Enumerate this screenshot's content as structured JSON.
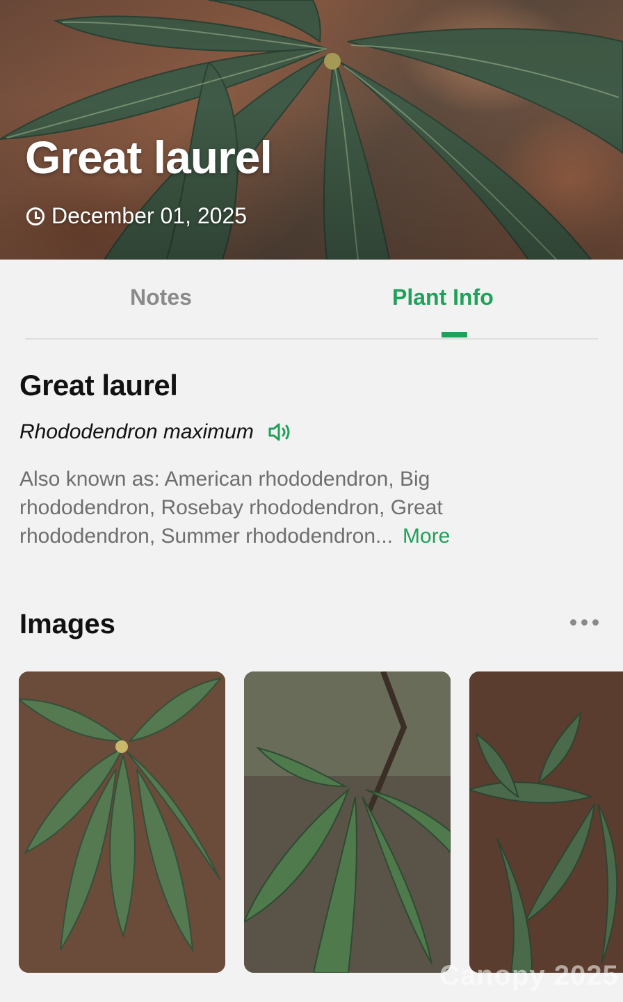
{
  "header": {
    "title": "Great laurel",
    "date": "December 01, 2025",
    "clock_icon": "clock-icon"
  },
  "tabs": [
    {
      "label": "Notes",
      "active": false
    },
    {
      "label": "Plant Info",
      "active": true
    }
  ],
  "colors": {
    "accent": "#1fa15a",
    "inactive_tab": "#8a8a8a",
    "background": "#f2f2f2"
  },
  "plant": {
    "common_name": "Great laurel",
    "scientific_name": "Rhododendron maximum",
    "audio_icon": "speaker-icon",
    "aka_lines": [
      "Also known as: American rhododendron, Big",
      "rhododendron, Rosebay rhododendron, Great",
      "rhododendron, Summer rhododendron..."
    ],
    "more_label": "More"
  },
  "images_section": {
    "title": "Images",
    "menu_icon": "more-horizontal-icon",
    "thumbnails": [
      "plant-photo-1",
      "plant-photo-2",
      "plant-photo-3"
    ]
  },
  "watermark": "Canopy 2025"
}
